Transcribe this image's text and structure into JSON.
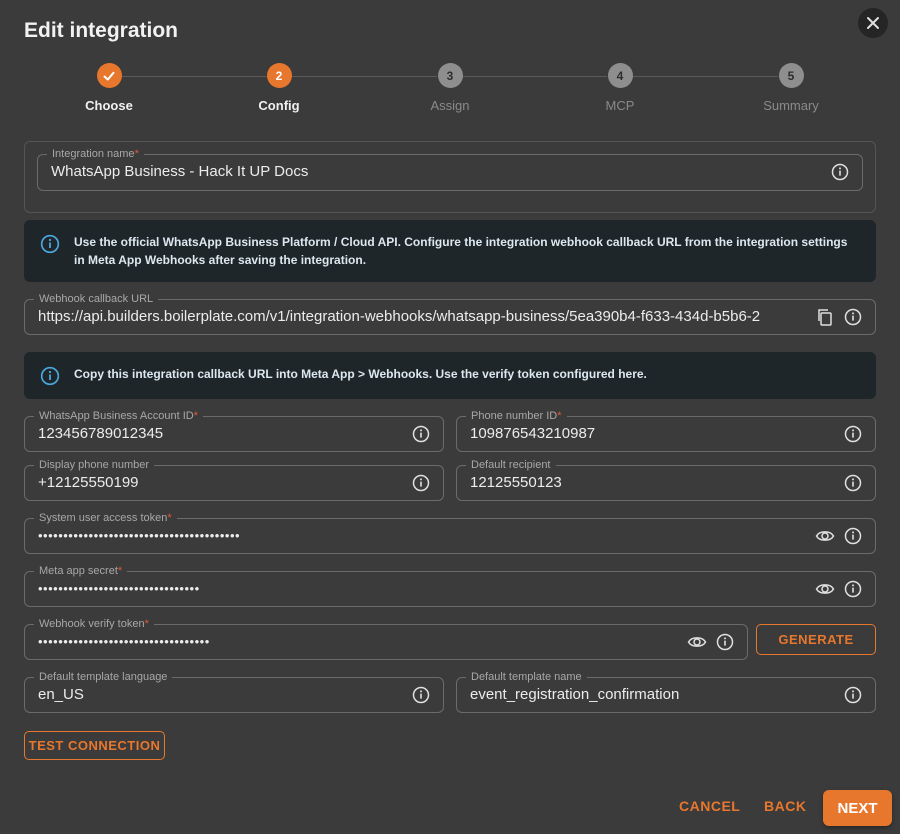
{
  "dialog": {
    "title": "Edit integration"
  },
  "stepper": {
    "steps": [
      {
        "number": "1",
        "label": "Choose",
        "state": "done"
      },
      {
        "number": "2",
        "label": "Config",
        "state": "active"
      },
      {
        "number": "3",
        "label": "Assign",
        "state": "pending"
      },
      {
        "number": "4",
        "label": "MCP",
        "state": "pending"
      },
      {
        "number": "5",
        "label": "Summary",
        "state": "pending"
      }
    ]
  },
  "fields": {
    "integration_name": {
      "label": "Integration name",
      "required": "*",
      "value": "WhatsApp Business - Hack It UP Docs"
    },
    "webhook_url": {
      "label": "Webhook callback URL",
      "value": "https://api.builders.boilerplate.com/v1/integration-webhooks/whatsapp-business/5ea390b4-f633-434d-b5b6-2"
    },
    "account_id": {
      "label": "WhatsApp Business Account ID",
      "required": "*",
      "value": "123456789012345"
    },
    "phone_number_id": {
      "label": "Phone number ID",
      "required": "*",
      "value": "109876543210987"
    },
    "display_phone": {
      "label": "Display phone number",
      "value": "+12125550199"
    },
    "default_recipient": {
      "label": "Default recipient",
      "value": "12125550123"
    },
    "access_token": {
      "label": "System user access token",
      "required": "*",
      "value": "••••••••••••••••••••••••••••••••••••••••"
    },
    "app_secret": {
      "label": "Meta app secret",
      "required": "*",
      "value": "••••••••••••••••••••••••••••••••"
    },
    "verify_token": {
      "label": "Webhook verify token",
      "required": "*",
      "value": "••••••••••••••••••••••••••••••••••"
    },
    "template_language": {
      "label": "Default template language",
      "value": "en_US"
    },
    "template_name": {
      "label": "Default template name",
      "value": "event_registration_confirmation"
    }
  },
  "banners": {
    "cloud_api": "Use the official WhatsApp Business Platform / Cloud API. Configure the integration webhook callback URL from the integration settings in Meta App Webhooks after saving the integration.",
    "copy_url": "Copy this integration callback URL into Meta App > Webhooks. Use the verify token configured here."
  },
  "buttons": {
    "generate": "GENERATE",
    "test_connection": "TEST CONNECTION",
    "cancel": "CANCEL",
    "back": "BACK",
    "next": "NEXT"
  },
  "colors": {
    "accent": "#e8772e",
    "background": "#3b3b3b",
    "banner": "#1f262a",
    "info_icon": "#4aa8e0"
  },
  "icons": [
    "close-icon",
    "check-icon",
    "info-icon",
    "copy-icon",
    "eye-icon"
  ]
}
